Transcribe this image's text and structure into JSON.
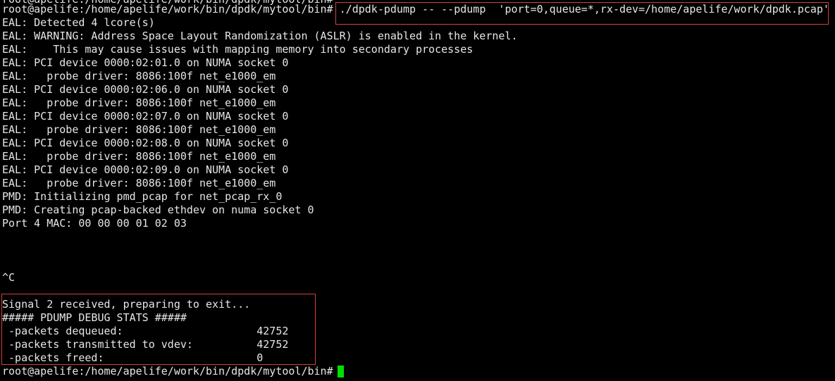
{
  "terminal": {
    "partial_top_line": "root@apelife:/home/apelife/work/bin/dpdk/mytool/bin#",
    "prompt": "root@apelife:/home/apelife/work/bin/dpdk/mytool/bin#",
    "command": "./dpdk-pdump -- --pdump  'port=0,queue=*,rx-dev=/home/apelife/work/dpdk.pcap'",
    "output": [
      "EAL: Detected 4 lcore(s)",
      "EAL: WARNING: Address Space Layout Randomization (ASLR) is enabled in the kernel.",
      "EAL:    This may cause issues with mapping memory into secondary processes",
      "EAL: PCI device 0000:02:01.0 on NUMA socket 0",
      "EAL:   probe driver: 8086:100f net_e1000_em",
      "EAL: PCI device 0000:02:06.0 on NUMA socket 0",
      "EAL:   probe driver: 8086:100f net_e1000_em",
      "EAL: PCI device 0000:02:07.0 on NUMA socket 0",
      "EAL:   probe driver: 8086:100f net_e1000_em",
      "EAL: PCI device 0000:02:08.0 on NUMA socket 0",
      "EAL:   probe driver: 8086:100f net_e1000_em",
      "EAL: PCI device 0000:02:09.0 on NUMA socket 0",
      "EAL:   probe driver: 8086:100f net_e1000_em",
      "PMD: Initializing pmd_pcap for net_pcap_rx_0",
      "PMD: Creating pcap-backed ethdev on numa socket 0",
      "Port 4 MAC: 00 00 00 01 02 03"
    ],
    "interrupt": "^C",
    "stats": [
      "Signal 2 received, preparing to exit...",
      "##### PDUMP DEBUG STATS #####",
      " -packets dequeued:                     42752",
      " -packets transmitted to vdev:          42752",
      " -packets freed:                        0"
    ],
    "final_prompt": "root@apelife:/home/apelife/work/bin/dpdk/mytool/bin#",
    "colors": {
      "background": "#000000",
      "text": "#e6e6e6",
      "highlight_box": "#d24040",
      "cursor": "#00e000"
    }
  }
}
